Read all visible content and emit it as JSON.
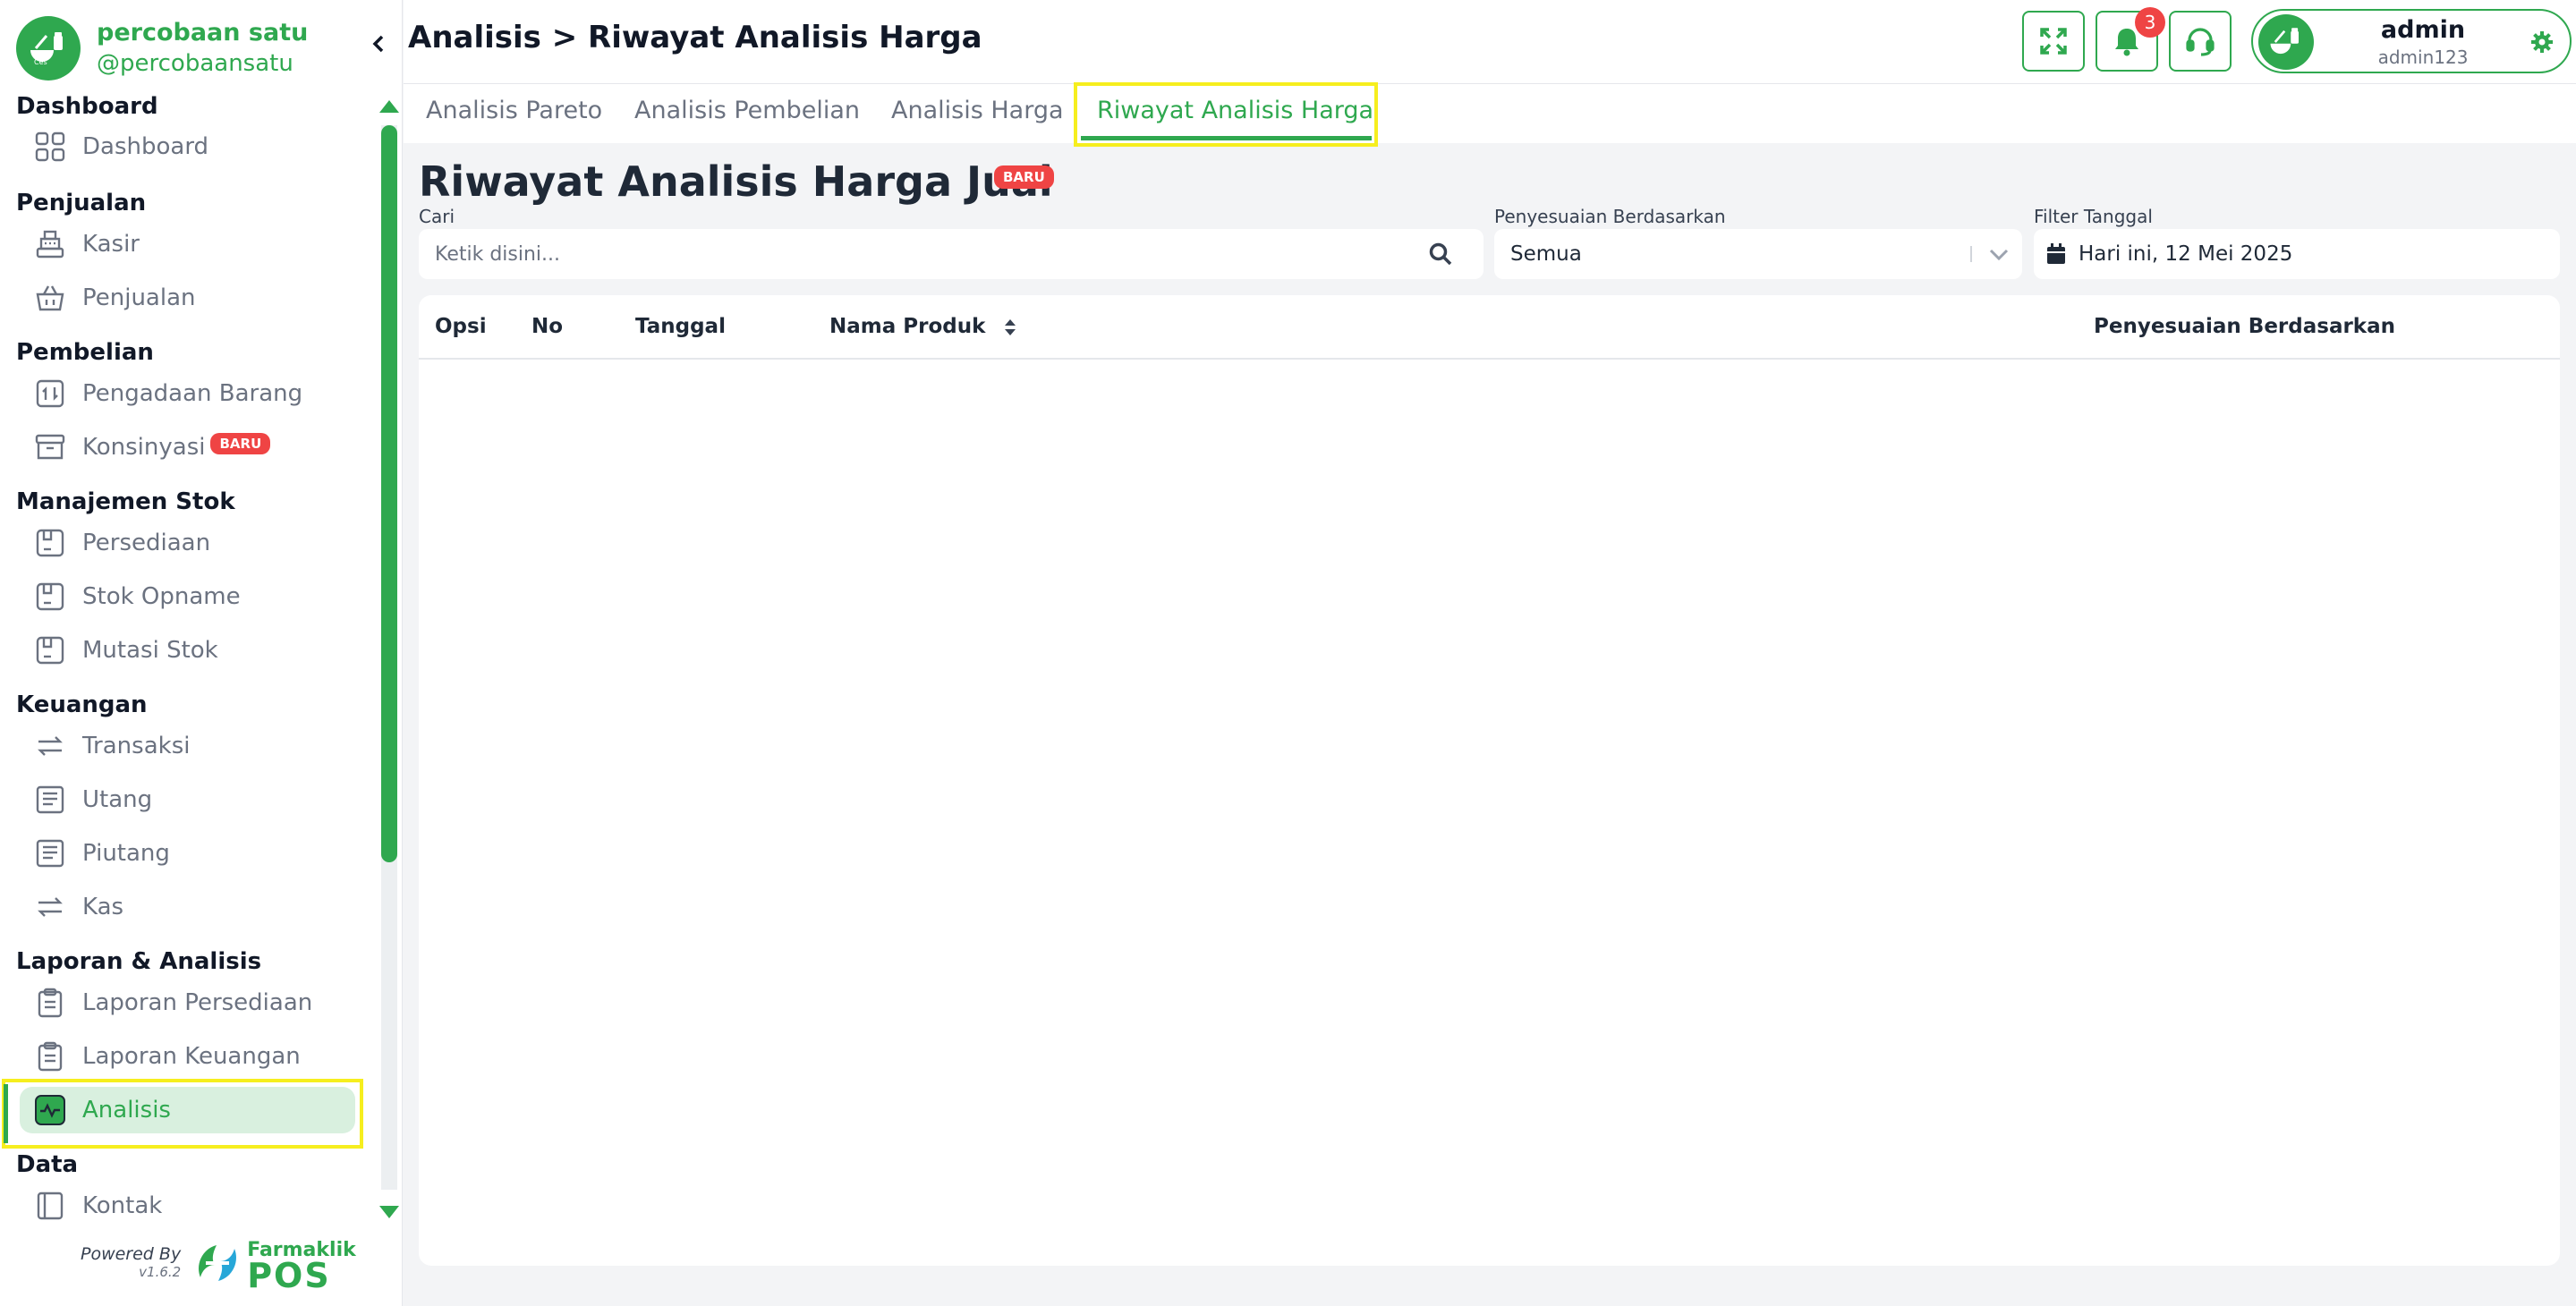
{
  "brand": {
    "name": "percobaan satu",
    "handle": "@percobaansatu"
  },
  "colors": {
    "accent": "#2fa84f",
    "badge": "#ef4444",
    "highlight": "#f6ee1e",
    "active_bg": "#d9f0df"
  },
  "sidebar": {
    "sections": [
      {
        "title": "Dashboard",
        "items": [
          {
            "label": "Dashboard",
            "icon": "grid-icon"
          }
        ]
      },
      {
        "title": "Penjualan",
        "items": [
          {
            "label": "Kasir",
            "icon": "cash-register-icon"
          },
          {
            "label": "Penjualan",
            "icon": "basket-icon"
          }
        ]
      },
      {
        "title": "Pembelian",
        "items": [
          {
            "label": "Pengadaan Barang",
            "icon": "procurement-icon"
          },
          {
            "label": "Konsinyasi",
            "icon": "archive-box-icon",
            "badge": "BARU"
          }
        ]
      },
      {
        "title": "Manajemen Stok",
        "items": [
          {
            "label": "Persediaan",
            "icon": "inventory-icon"
          },
          {
            "label": "Stok Opname",
            "icon": "stock-opname-icon"
          },
          {
            "label": "Mutasi Stok",
            "icon": "stock-mutation-icon"
          }
        ]
      },
      {
        "title": "Keuangan",
        "items": [
          {
            "label": "Transaksi",
            "icon": "transfer-icon"
          },
          {
            "label": "Utang",
            "icon": "ledger-icon"
          },
          {
            "label": "Piutang",
            "icon": "receipt-icon"
          },
          {
            "label": "Kas",
            "icon": "exchange-icon"
          }
        ]
      },
      {
        "title": "Laporan & Analisis",
        "items": [
          {
            "label": "Laporan Persediaan",
            "icon": "clipboard-icon"
          },
          {
            "label": "Laporan Keuangan",
            "icon": "clipboard-icon"
          },
          {
            "label": "Analisis",
            "icon": "activity-icon",
            "active": true
          }
        ]
      },
      {
        "title": "Data",
        "items": [
          {
            "label": "Kontak",
            "icon": "contact-book-icon"
          }
        ]
      }
    ]
  },
  "footer": {
    "powered_by": "Powered By",
    "version": "v1.6.2",
    "product_name": "Farmaklik",
    "product_suffix": "POS"
  },
  "header": {
    "breadcrumb": "Analisis > Riwayat Analisis Harga",
    "notification_count": "3",
    "user": {
      "name": "admin",
      "username": "admin123"
    }
  },
  "tabs": [
    {
      "label": "Analisis Pareto"
    },
    {
      "label": "Analisis Pembelian"
    },
    {
      "label": "Analisis Harga"
    },
    {
      "label": "Riwayat Analisis Harga",
      "active": true
    }
  ],
  "page": {
    "title": "Riwayat Analisis Harga Jual",
    "badge": "BARU",
    "search": {
      "label": "Cari",
      "placeholder": "Ketik disini..."
    },
    "adjustment": {
      "label": "Penyesuaian Berdasarkan",
      "value": "Semua"
    },
    "date_filter": {
      "label": "Filter Tanggal",
      "value": "Hari ini, 12 Mei 2025"
    }
  },
  "table": {
    "columns": [
      "Opsi",
      "No",
      "Tanggal",
      "Nama Produk",
      "Penyesuaian Berdasarkan"
    ],
    "rows": []
  }
}
